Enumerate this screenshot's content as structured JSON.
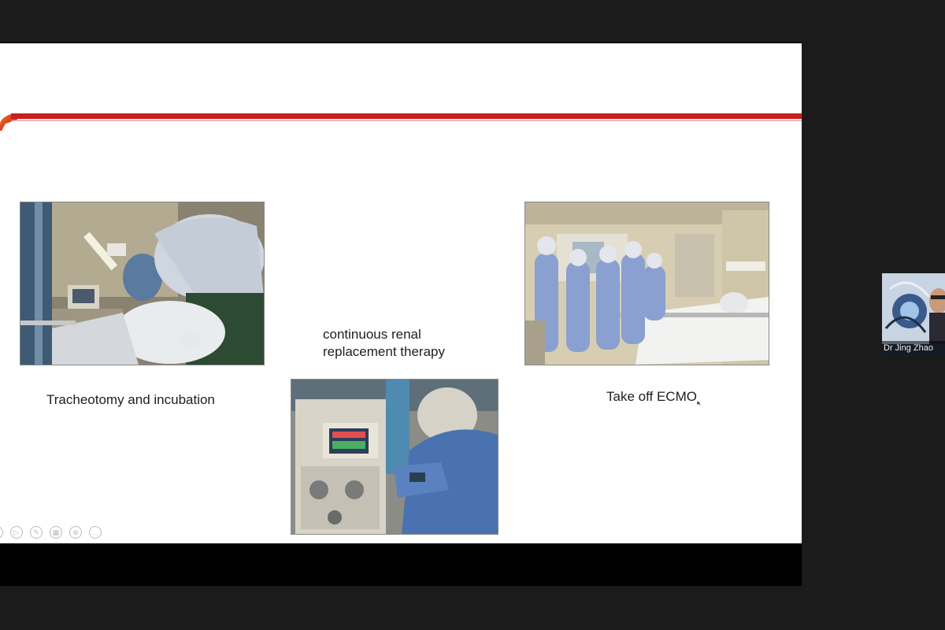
{
  "slide": {
    "captions": {
      "left": "Tracheotomy and incubation",
      "middle_line1": "continuous renal",
      "middle_line2": "replacement therapy",
      "right": "Take off ECMO"
    },
    "nav_icons": [
      "prev-icon",
      "play-icon",
      "pen-icon",
      "grid-icon",
      "zoom-icon",
      "more-icon"
    ],
    "nav_glyphs": [
      "‹",
      "▷",
      "✎",
      "▦",
      "⊕",
      "…"
    ]
  },
  "participant": {
    "name": "Dr Jing Zhao"
  },
  "colors": {
    "slide_accent": "#c8201e",
    "frame_bg": "#1b1b1b"
  }
}
